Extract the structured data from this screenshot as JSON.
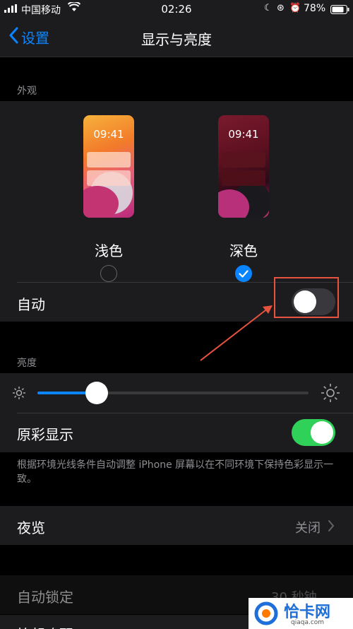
{
  "status": {
    "carrier": "中国移动",
    "time": "02:26",
    "battery": "78%"
  },
  "nav": {
    "back_label": "设置",
    "title": "显示与亮度"
  },
  "appearance": {
    "section_label": "外观",
    "light": {
      "time": "09:41",
      "label": "浅色",
      "selected": false
    },
    "dark": {
      "time": "09:41",
      "label": "深色",
      "selected": true
    },
    "auto_label": "自动",
    "auto_on": false
  },
  "brightness": {
    "section_label": "亮度",
    "level": 0.22,
    "true_tone_label": "原彩显示",
    "true_tone_on": true,
    "footer": "根据环境光线条件自动调整 iPhone 屏幕以在不同环境下保持色彩显示一致。"
  },
  "night_shift": {
    "label": "夜览",
    "value": "关闭"
  },
  "auto_lock": {
    "label": "自动锁定",
    "value": "30 秒钟"
  },
  "raise_to_wake": {
    "label": "抬起唤醒"
  },
  "watermark": {
    "text": "恰卡网",
    "url": "qiaqa.com"
  },
  "colors": {
    "accent": "#0a84ff",
    "green": "#30d158",
    "annotation": "#e8533f"
  }
}
